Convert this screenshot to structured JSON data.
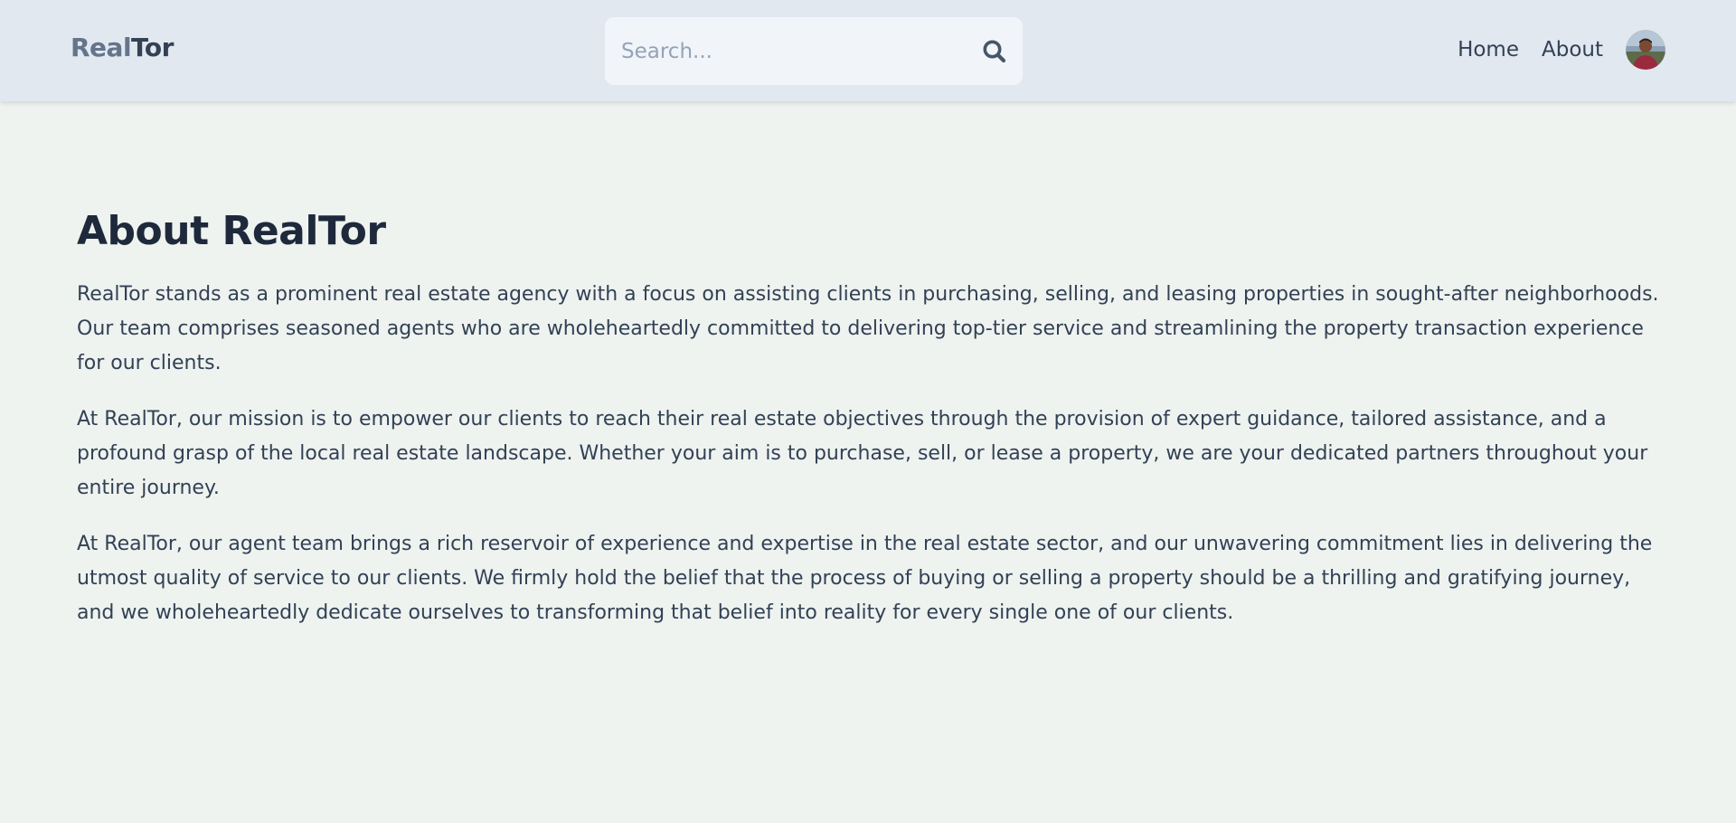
{
  "header": {
    "logo": {
      "part1": "Real",
      "part2": "Tor"
    },
    "search": {
      "placeholder": "Search...",
      "value": ""
    },
    "nav": [
      {
        "label": "Home"
      },
      {
        "label": "About"
      }
    ]
  },
  "main": {
    "title": "About RealTor",
    "paragraphs": [
      "RealTor stands as a prominent real estate agency with a focus on assisting clients in purchasing, selling, and leasing properties in sought-after neighborhoods. Our team comprises seasoned agents who are wholeheartedly committed to delivering top-tier service and streamlining the property transaction experience for our clients.",
      "At RealTor, our mission is to empower our clients to reach their real estate objectives through the provision of expert guidance, tailored assistance, and a profound grasp of the local real estate landscape. Whether your aim is to purchase, sell, or lease a property, we are your dedicated partners throughout your entire journey.",
      "At RealTor, our agent team brings a rich reservoir of experience and expertise in the real estate sector, and our unwavering commitment lies in delivering the utmost quality of service to our clients. We firmly hold the belief that the process of buying or selling a property should be a thrilling and gratifying journey, and we wholeheartedly dedicate ourselves to transforming that belief into reality for every single one of our clients."
    ]
  },
  "colors": {
    "header_bg": "#e2e8f0",
    "page_bg": "#eef3f0",
    "logo_light": "#64748b",
    "logo_dark": "#334155",
    "title": "#1e293b",
    "text": "#334155"
  },
  "icons": {
    "search": "search-icon",
    "avatar": "avatar"
  }
}
